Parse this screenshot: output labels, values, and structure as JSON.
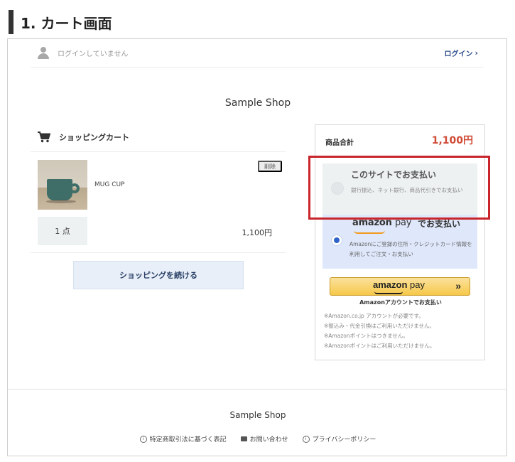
{
  "heading": "1. カート画面",
  "login": {
    "status": "ログインしていません",
    "link_label": "ログイン",
    "chevron": "›"
  },
  "shop_name": "Sample Shop",
  "cart": {
    "title": "ショッピングカート",
    "item": {
      "name": "MUG CUP",
      "delete_label": "削除",
      "quantity": "1 点",
      "price": "1,100円"
    },
    "continue_label": "ショッピングを続ける"
  },
  "summary": {
    "total_label": "商品合計",
    "total_value": "1,100円",
    "option_site": {
      "title": "このサイトでお支払い",
      "description": "銀行振込、ネット銀行、商品代引きでお支払い"
    },
    "option_amazon": {
      "logo_main": "amazon",
      "logo_pay": "pay",
      "title": "でお支払い",
      "description": "Amazonにご登録の住所・クレジットカード情報を利用してご注文・お支払い"
    },
    "amazon_button": {
      "logo_main": "amazon",
      "logo_pay": "pay",
      "arrows": "»",
      "caption": "Amazonアカウントでお支払い"
    },
    "notes": [
      "※Amazon.co.jp アカウントが必要です。",
      "※振込み・代金引換はご利用いただけません。",
      "※Amazonポイントはつきません。",
      "※Amazonポイントはご利用いただけません。"
    ]
  },
  "footer": {
    "shop_name": "Sample Shop",
    "links": [
      {
        "icon": "info-icon",
        "glyph": "i",
        "label": "特定商取引法に基づく表記"
      },
      {
        "icon": "mail-icon",
        "glyph": "",
        "label": "お問い合わせ"
      },
      {
        "icon": "info-icon",
        "glyph": "i",
        "label": "プライバシーポリシー"
      }
    ]
  },
  "colors": {
    "price_accent": "#d04a35",
    "highlight": "#c8242c",
    "selected_radio": "#2f64c9"
  }
}
